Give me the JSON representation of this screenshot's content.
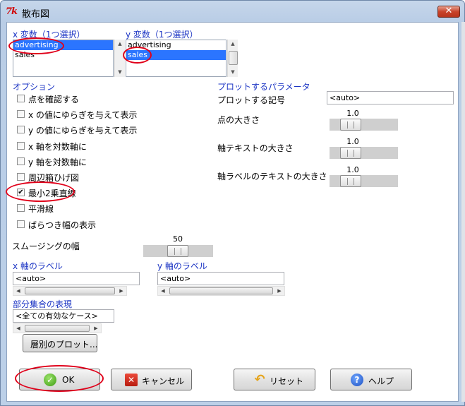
{
  "window": {
    "title": "散布図",
    "app_icon": "7k"
  },
  "x_var": {
    "label": "x 変数（1つ選択）",
    "items": [
      "advertising",
      "sales"
    ],
    "selected": 0
  },
  "y_var": {
    "label": "y 変数（1つ選択）",
    "items": [
      "advertising",
      "sales"
    ],
    "selected": 1
  },
  "options": {
    "label": "オプション",
    "items": [
      {
        "label": "点を確認する",
        "checked": false
      },
      {
        "label": "x の値にゆらぎを与えて表示",
        "checked": false
      },
      {
        "label": "y の値にゆらぎを与えて表示",
        "checked": false
      },
      {
        "label": "x 軸を対数軸に",
        "checked": false
      },
      {
        "label": "y 軸を対数軸に",
        "checked": false
      },
      {
        "label": "周辺箱ひげ図",
        "checked": false
      },
      {
        "label": "最小2乗直線",
        "checked": true
      },
      {
        "label": "平滑線",
        "checked": false
      },
      {
        "label": "ばらつき幅の表示",
        "checked": false
      }
    ]
  },
  "smoothing": {
    "label": "スムージングの幅",
    "value": "50"
  },
  "plot_params": {
    "label": "プロットするパラメータ",
    "symbol_label": "プロットする記号",
    "symbol_value": "<auto>",
    "point_size_label": "点の大きさ",
    "point_size_value": "1.0",
    "axis_text_size_label": "軸テキストの大きさ",
    "axis_text_size_value": "1.0",
    "axis_label_text_size_label": "軸ラベルのテキストの大きさ",
    "axis_label_text_size_value": "1.0"
  },
  "x_axis_label": {
    "label": "x 軸のラベル",
    "value": "<auto>"
  },
  "y_axis_label": {
    "label": "y 軸のラベル",
    "value": "<auto>"
  },
  "subset": {
    "label": "部分集合の表現",
    "value": "<全ての有効なケース>"
  },
  "buttons": {
    "stratified": "層別のプロット...",
    "ok": "OK",
    "cancel": "キャンセル",
    "reset": "リセット",
    "help": "ヘルプ"
  },
  "colors": {
    "accent_blue": "#1c35c4",
    "selection": "#2b75ff",
    "annotation_red": "#e0001a"
  }
}
